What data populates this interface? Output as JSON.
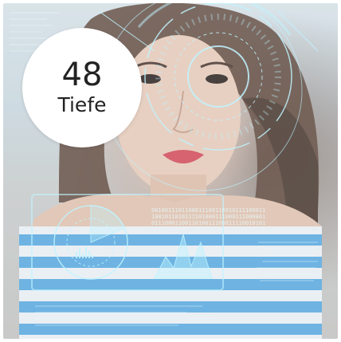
{
  "badge": {
    "number": "48",
    "label": "Tiefe"
  },
  "colors": {
    "hud": "#bff3ff",
    "badge_bg": "#ffffff",
    "stripes": "#4fa6e3"
  }
}
